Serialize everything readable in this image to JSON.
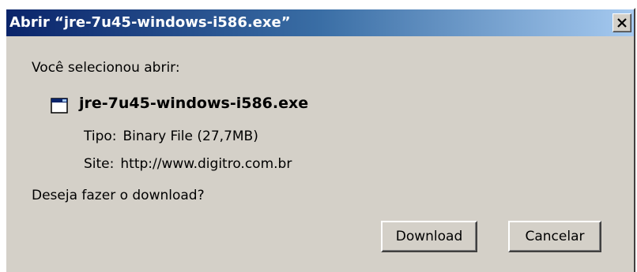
{
  "window": {
    "title": "Abrir “jre-7u45-windows-i586.exe”"
  },
  "dialog": {
    "prompt": "Você selecionou abrir:",
    "file": {
      "name": "jre-7u45-windows-i586.exe",
      "icon": "application-window-icon"
    },
    "type_label": "Tipo:",
    "type_value": "Binary File (27,7MB)",
    "site_label": "Site:",
    "site_value": "http://www.digitro.com.br",
    "question": "Deseja fazer o download?"
  },
  "buttons": {
    "download": "Download",
    "cancel": "Cancelar"
  },
  "colors": {
    "titlebar_start": "#0a246a",
    "titlebar_end": "#a6caf0",
    "face": "#d4d0c8"
  }
}
